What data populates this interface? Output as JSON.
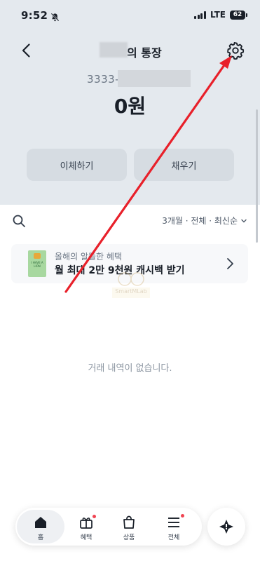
{
  "status_bar": {
    "time": "9:52",
    "network": "LTE",
    "battery": "62"
  },
  "header": {
    "title": "의 통장",
    "account_number": "3333-",
    "balance": "0원"
  },
  "actions": {
    "transfer": "이체하기",
    "charge": "채우기"
  },
  "filter": {
    "label": "3개월 · 전체 · 최신순"
  },
  "promo": {
    "subtitle": "올해의 알뜰한 혜택",
    "title": "월 최대 2만 9천원 캐시백 받기",
    "thumb_text": "I HAVE A LION"
  },
  "empty_message": "거래 내역이 없습니다.",
  "watermark": "SmartMLab",
  "nav": [
    {
      "label": "홈",
      "icon": "home-icon",
      "active": true
    },
    {
      "label": "혜택",
      "icon": "gift-icon",
      "badge": true
    },
    {
      "label": "상품",
      "icon": "bag-icon"
    },
    {
      "label": "전체",
      "icon": "menu-icon",
      "badge": true
    }
  ],
  "colors": {
    "header_bg": "#e4e9ee",
    "annotation_arrow": "#e8202a",
    "badge": "#f04452"
  }
}
